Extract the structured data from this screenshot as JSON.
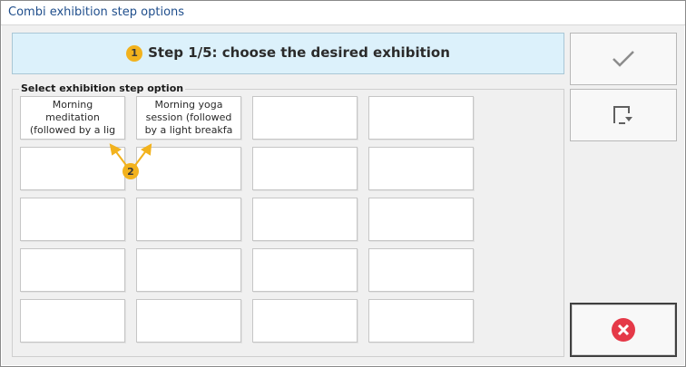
{
  "window": {
    "title": "Combi exhibition step options"
  },
  "header": {
    "step_text": "Step 1/5: choose the desired exhibition",
    "marker": "1"
  },
  "group": {
    "label": "Select exhibition step option"
  },
  "options": [
    {
      "label": "Morning\nmeditation\n(followed by a lig"
    },
    {
      "label": "Morning yoga\nsession (followed\nby a light breakfa"
    }
  ],
  "annotation": {
    "marker": "2"
  },
  "side_buttons": {
    "confirm_icon": "checkmark-icon",
    "next_icon": "next-step-icon",
    "cancel_icon": "close-circle-icon"
  },
  "colors": {
    "accent": "#f2b21d",
    "cancel": "#e53948",
    "header_bg": "#dcf1fb",
    "title": "#1f4e8c"
  }
}
